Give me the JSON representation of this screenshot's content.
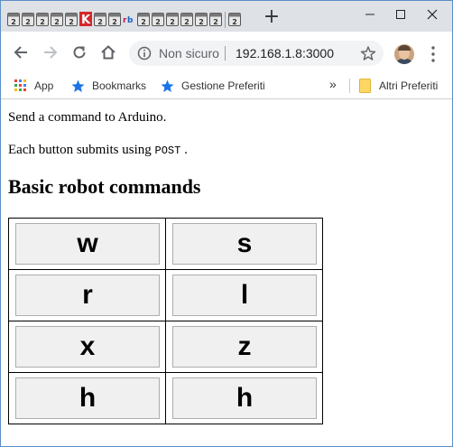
{
  "browser": {
    "tab_favicons": [
      "calendar-icon",
      "calendar-icon",
      "calendar-icon",
      "calendar-icon",
      "calendar-icon",
      "red-k-icon",
      "calendar-icon",
      "calendar-icon",
      "rb-icon",
      "calendar-icon",
      "calendar-icon",
      "calendar-icon",
      "calendar-icon",
      "calendar-icon",
      "calendar-icon",
      "calendar-icon"
    ],
    "new_tab_label": "+",
    "omnibox": {
      "security_label": "Non sicuro",
      "url": "192.168.1.8:3000"
    },
    "bookmarks": {
      "items": [
        {
          "label": "App",
          "icon": "apps-grid-icon"
        },
        {
          "label": "Bookmarks",
          "icon": "star-icon"
        },
        {
          "label": "Gestione Preferiti",
          "icon": "star-icon"
        }
      ],
      "more_label": "»",
      "other_label": "Altri Preferiti"
    }
  },
  "page": {
    "intro": "Send a command to Arduino.",
    "submit_text_before": "Each button submits using",
    "submit_method": "POST",
    "submit_text_after": ".",
    "heading": "Basic robot commands",
    "commands": [
      [
        "w",
        "s"
      ],
      [
        "r",
        "l"
      ],
      [
        "x",
        "z"
      ],
      [
        "h",
        "h"
      ]
    ]
  }
}
